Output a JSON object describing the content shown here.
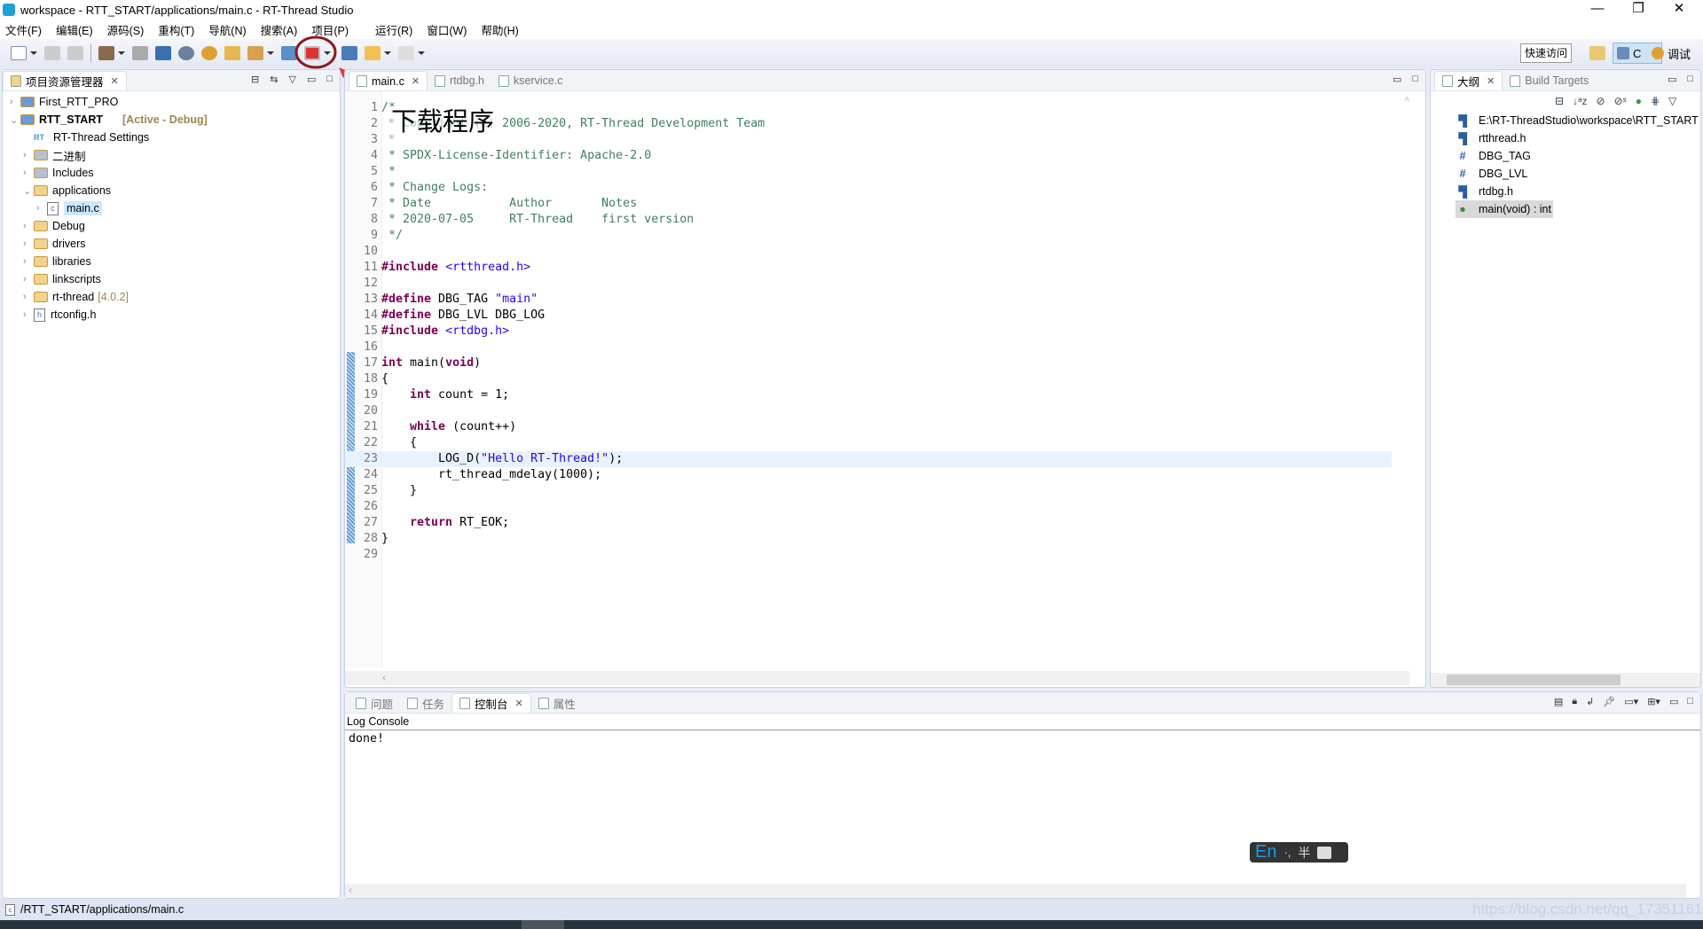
{
  "window": {
    "title": "workspace - RTT_START/applications/main.c - RT-Thread Studio",
    "minimize": "—",
    "restore": "❐",
    "close": "✕"
  },
  "menu": [
    "文件(F)",
    "编辑(E)",
    "源码(S)",
    "重构(T)",
    "导航(N)",
    "搜索(A)",
    "项目(P)",
    "运行(R)",
    "窗口(W)",
    "帮助(H)"
  ],
  "toolbar": {
    "quick_access": "快速访问",
    "perspective_c": "C",
    "perspective_debug": "调试"
  },
  "annotation": {
    "label": "下载程序",
    "color": "#c0392b"
  },
  "explorer": {
    "title": "项目资源管理器",
    "items": [
      {
        "label": "First_RTT_PRO",
        "level": 0,
        "expanded": false,
        "type": "project"
      },
      {
        "label": "RTT_START",
        "suffix": "[Active - Debug]",
        "level": 0,
        "expanded": true,
        "type": "project"
      },
      {
        "label": "RT-Thread Settings",
        "level": 1,
        "type": "settings"
      },
      {
        "label": "二进制",
        "level": 1,
        "expanded": false,
        "type": "binaries"
      },
      {
        "label": "Includes",
        "level": 1,
        "expanded": false,
        "type": "includes"
      },
      {
        "label": "applications",
        "level": 1,
        "expanded": true,
        "type": "folder"
      },
      {
        "label": "main.c",
        "level": 2,
        "expanded": false,
        "type": "c-file",
        "selected": true
      },
      {
        "label": "Debug",
        "level": 1,
        "expanded": false,
        "type": "folder"
      },
      {
        "label": "drivers",
        "level": 1,
        "expanded": false,
        "type": "folder"
      },
      {
        "label": "libraries",
        "level": 1,
        "expanded": false,
        "type": "folder"
      },
      {
        "label": "linkscripts",
        "level": 1,
        "expanded": false,
        "type": "folder"
      },
      {
        "label": "rt-thread",
        "suffix": "[4.0.2]",
        "level": 1,
        "expanded": false,
        "type": "folder"
      },
      {
        "label": "rtconfig.h",
        "level": 1,
        "expanded": false,
        "type": "h-file"
      }
    ]
  },
  "editor": {
    "tabs": [
      {
        "label": "main.c",
        "active": true
      },
      {
        "label": "rtdbg.h"
      },
      {
        "label": "kservice.c"
      }
    ],
    "highlighted_line": 23,
    "lines": [
      [
        [
          "cm",
          "/*"
        ]
      ],
      [
        [
          "cm",
          " * Copyright (c) 2006-2020, RT-Thread Development Team"
        ]
      ],
      [
        [
          "cm",
          " *"
        ]
      ],
      [
        [
          "cm",
          " * SPDX-License-Identifier: Apache-2.0"
        ]
      ],
      [
        [
          "cm",
          " *"
        ]
      ],
      [
        [
          "cm",
          " * Change Logs:"
        ]
      ],
      [
        [
          "cm",
          " * Date           Author       Notes"
        ]
      ],
      [
        [
          "cm",
          " * 2020-07-05     RT-Thread    first version"
        ]
      ],
      [
        [
          "cm",
          " */"
        ]
      ],
      [],
      [
        [
          "kw",
          "#include "
        ],
        [
          "st",
          "<rtthread.h>"
        ]
      ],
      [],
      [
        [
          "kw",
          "#define "
        ],
        [
          "nm",
          "DBG_TAG "
        ],
        [
          "st",
          "\"main\""
        ]
      ],
      [
        [
          "kw",
          "#define "
        ],
        [
          "nm",
          "DBG_LVL DBG_LOG"
        ]
      ],
      [
        [
          "kw",
          "#include "
        ],
        [
          "st",
          "<rtdbg.h>"
        ]
      ],
      [],
      [
        [
          "kw",
          "int "
        ],
        [
          "nm",
          "main("
        ],
        [
          "kw",
          "void"
        ],
        [
          "nm",
          ")"
        ]
      ],
      [
        [
          "nm",
          "{"
        ]
      ],
      [
        [
          "kw",
          "    int "
        ],
        [
          "nm",
          "count = 1;"
        ]
      ],
      [],
      [
        [
          "kw",
          "    while "
        ],
        [
          "nm",
          "(count++)"
        ]
      ],
      [
        [
          "nm",
          "    {"
        ]
      ],
      [
        [
          "nm",
          "        LOG_D("
        ],
        [
          "st",
          "\"Hello RT-Thread!\""
        ],
        [
          "nm",
          ");"
        ]
      ],
      [
        [
          "nm",
          "        rt_thread_mdelay(1000);"
        ]
      ],
      [
        [
          "nm",
          "    }"
        ]
      ],
      [],
      [
        [
          "kw",
          "    return "
        ],
        [
          "nm",
          "RT_EOK;"
        ]
      ],
      [
        [
          "nm",
          "}"
        ]
      ],
      []
    ]
  },
  "outline": {
    "tabs": [
      {
        "label": "大纲",
        "active": true
      },
      {
        "label": "Build Targets"
      }
    ],
    "items": [
      {
        "label": "E:\\RT-ThreadStudio\\workspace\\RTT_START",
        "icon": "include-icon"
      },
      {
        "label": "rtthread.h",
        "icon": "include-icon"
      },
      {
        "label": "DBG_TAG",
        "icon": "macro-icon"
      },
      {
        "label": "DBG_LVL",
        "icon": "macro-icon"
      },
      {
        "label": "rtdbg.h",
        "icon": "include-icon"
      },
      {
        "label": "main(void) : int",
        "icon": "function-icon",
        "selected": true
      }
    ]
  },
  "console": {
    "tabs": [
      {
        "label": "问题"
      },
      {
        "label": "任务"
      },
      {
        "label": "控制台",
        "active": true
      },
      {
        "label": "属性"
      }
    ],
    "name": "Log Console",
    "output": "done!"
  },
  "ime": {
    "mode": "En",
    "punct": "·,",
    "width": "半"
  },
  "status": {
    "path": "/RTT_START/applications/main.c",
    "watermark": "https://blog.csdn.net/qq_17351161"
  }
}
